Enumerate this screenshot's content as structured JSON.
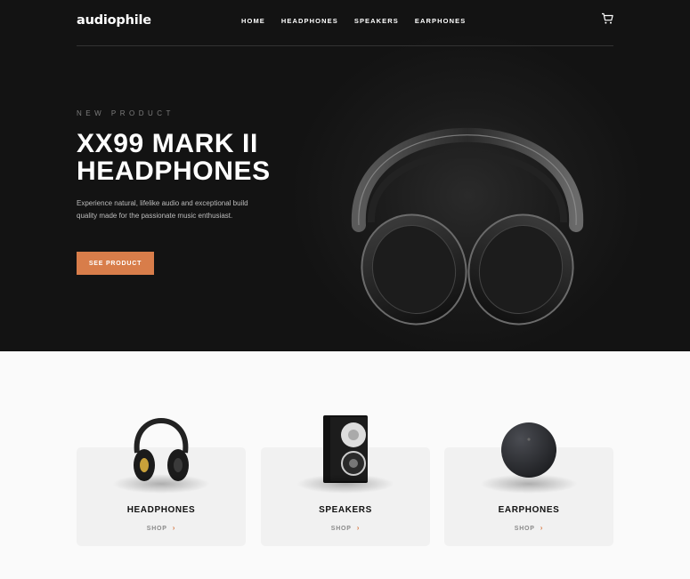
{
  "brand": {
    "logo": "audiophile",
    "accent": "#d87d4a"
  },
  "nav": {
    "links": [
      "HOME",
      "HEADPHONES",
      "SPEAKERS",
      "EARPHONES"
    ],
    "cart_icon": "cart-icon"
  },
  "hero": {
    "overline": "NEW PRODUCT",
    "title": "XX99 MARK II HEADPHONES",
    "description": "Experience natural, lifelike audio and exceptional build quality made for the passionate music enthusiast.",
    "cta_label": "SEE PRODUCT"
  },
  "categories": [
    {
      "title": "HEADPHONES",
      "link": "SHOP"
    },
    {
      "title": "SPEAKERS",
      "link": "SHOP"
    },
    {
      "title": "EARPHONES",
      "link": "SHOP"
    }
  ]
}
